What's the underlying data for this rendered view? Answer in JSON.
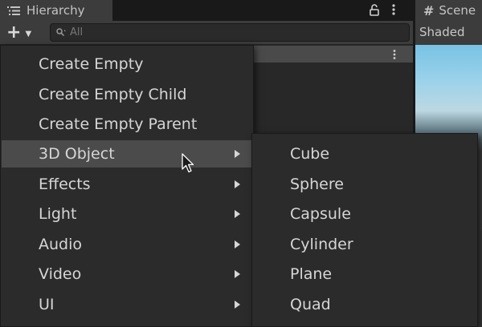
{
  "hierarchy": {
    "tab_title": "Hierarchy",
    "search_placeholder": "All"
  },
  "scene": {
    "tab_title": "Scene",
    "shading_mode": "Shaded"
  },
  "context_menu": {
    "items": [
      {
        "label": "Create Empty"
      },
      {
        "label": "Create Empty Child"
      },
      {
        "label": "Create Empty Parent"
      },
      {
        "label": "3D Object"
      },
      {
        "label": "Effects"
      },
      {
        "label": "Light"
      },
      {
        "label": "Audio"
      },
      {
        "label": "Video"
      },
      {
        "label": "UI"
      }
    ]
  },
  "submenu_3d_object": {
    "items": [
      {
        "label": "Cube"
      },
      {
        "label": "Sphere"
      },
      {
        "label": "Capsule"
      },
      {
        "label": "Cylinder"
      },
      {
        "label": "Plane"
      },
      {
        "label": "Quad"
      }
    ]
  },
  "icons": {
    "hierarchy_tab": "list-icon",
    "lock": "lock-icon",
    "more": "kebab-menu-icon",
    "add": "plus-icon",
    "search": "search-icon",
    "scene_tab": "hash-icon",
    "submenu_arrow": "chevron-right-icon",
    "cursor": "mouse-cursor-icon"
  },
  "colors": {
    "panel_background": "#282828",
    "tab_background": "#3c3c3c",
    "menu_background": "#2b2b2b",
    "menu_highlight": "#4b4b4b",
    "text": "#d6d6d6",
    "skybox_top": "#78c2e4"
  }
}
